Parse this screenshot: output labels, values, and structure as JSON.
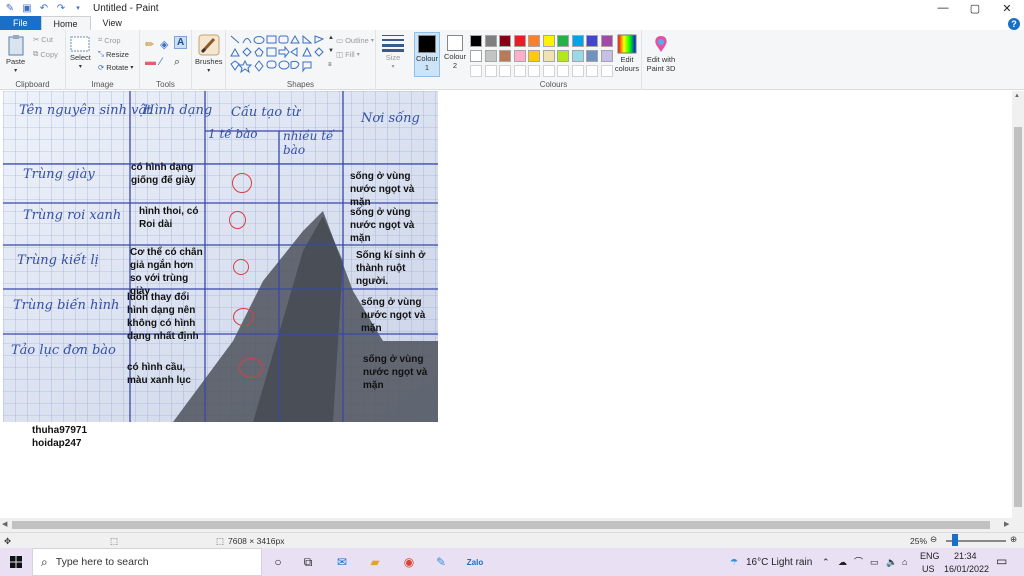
{
  "window": {
    "title": "Untitled - Paint",
    "controls": [
      "minimize",
      "maximize",
      "close"
    ]
  },
  "tabs": [
    {
      "label": "File"
    },
    {
      "label": "Home"
    },
    {
      "label": "View"
    }
  ],
  "ribbon": {
    "clipboard": {
      "label": "Clipboard",
      "paste": "Paste",
      "cut": "Cut",
      "copy": "Copy"
    },
    "image": {
      "label": "Image",
      "select": "Select",
      "crop": "Crop",
      "resize": "Resize",
      "rotate": "Rotate"
    },
    "tools": {
      "label": "Tools",
      "brushes": "Brushes"
    },
    "shapes": {
      "label": "Shapes",
      "outline": "Outline",
      "fill": "Fill"
    },
    "size": {
      "label": "Size"
    },
    "colour1": {
      "label": "Colour 1",
      "color": "#000000"
    },
    "colour2": {
      "label": "Colour 2",
      "color": "#ffffff"
    },
    "colours": {
      "label": "Colours",
      "palette_row1": [
        "#000000",
        "#7f7f7f",
        "#880015",
        "#ed1c24",
        "#ff7f27",
        "#fff200",
        "#22b14c",
        "#00a2e8",
        "#3f48cc",
        "#a349a4"
      ],
      "palette_row2": [
        "#ffffff",
        "#c3c3c3",
        "#b97a57",
        "#ffaec9",
        "#ffc90e",
        "#efe4b0",
        "#b5e61d",
        "#99d9ea",
        "#7092be",
        "#c8bfe7"
      ],
      "edit_colours": "Edit colours"
    },
    "paint3d": {
      "label": "Edit with Paint 3D"
    }
  },
  "photo": {
    "headers": {
      "col1": "Tên nguyên sinh vật",
      "col2": "Hình dạng",
      "col3_top": "Cấu tạo từ",
      "col3a": "1 tế bào",
      "col3b": "nhiều tế bào",
      "col4": "Nơi sống"
    },
    "rows": [
      {
        "name": "Trùng giày",
        "shape": "có hình dạng giống đế giày",
        "habitat": "sống ở vùng nước ngọt và mặn"
      },
      {
        "name": "Trùng roi xanh",
        "shape": "hình thoi, có Roi dài",
        "habitat": "sống ở vùng nước ngọt và mặn"
      },
      {
        "name": "Trùng kiết lị",
        "shape": "Cơ thể có chân giả ngắn hơn so với trùng giày",
        "habitat": "Sống kí sinh ở thành ruột người."
      },
      {
        "name": "Trùng biến hình",
        "shape": "luôn thay đổi hình dạng nên không có hình dạng nhất định",
        "habitat": "sống ở vùng nước ngọt và mặn"
      },
      {
        "name": "Tảo lục đơn bào",
        "shape": "có hình cầu, màu xanh lục",
        "habitat": "sống ở vùng nước ngọt và mặn"
      }
    ]
  },
  "credits": [
    "thuha97971",
    "hoidap247"
  ],
  "statusbar": {
    "dimensions": "7608 × 3416px",
    "zoom": "25%"
  },
  "taskbar": {
    "search_placeholder": "Type here to search",
    "weather": "16°C  Light rain",
    "lang": "ENG",
    "region": "US",
    "time": "21:34",
    "date": "16/01/2022"
  }
}
